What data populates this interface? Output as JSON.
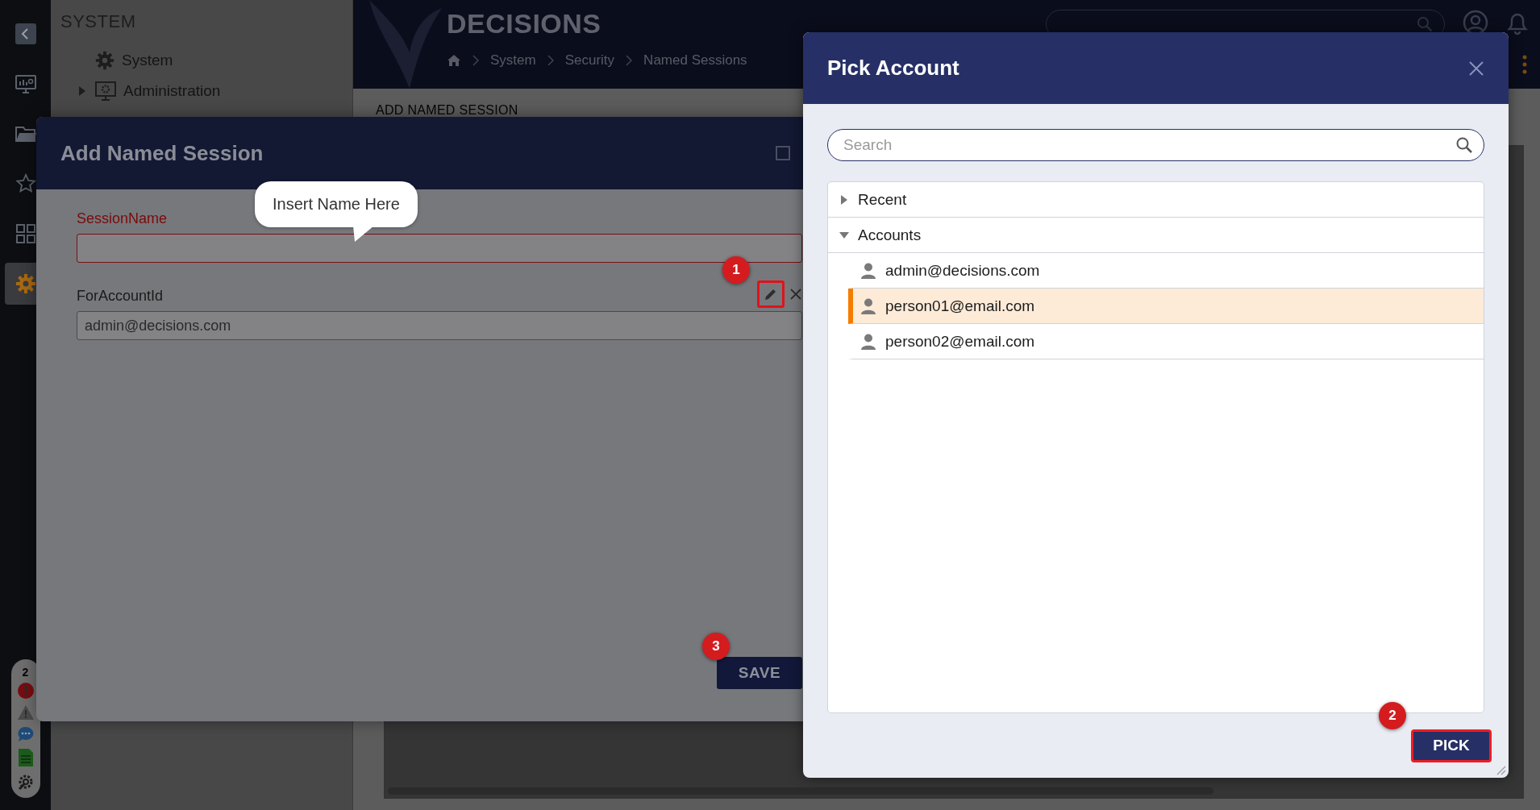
{
  "nav_rail": {
    "items": [
      {
        "selected": false
      },
      {
        "selected": false
      },
      {
        "selected": false
      },
      {
        "selected": false
      },
      {
        "selected": false
      },
      {
        "selected": true
      }
    ],
    "notifications": {
      "count": "2"
    }
  },
  "sidebar": {
    "title": "SYSTEM",
    "items": [
      {
        "label": "System"
      },
      {
        "label": "Administration",
        "expanded": false
      }
    ]
  },
  "header": {
    "brand": "DECISIONS",
    "breadcrumb": [
      "System",
      "Security",
      "Named Sessions"
    ]
  },
  "page": {
    "heading": "ADD NAMED SESSION"
  },
  "add_dialog": {
    "title": "Add Named Session",
    "tooltip": "Insert Name Here",
    "fields": [
      {
        "label": "SessionName",
        "invalid": true
      },
      {
        "label": "ForAccountId",
        "value": "admin@decisions.com",
        "invalid": false,
        "edit_highlighted": true,
        "callout": "1"
      }
    ],
    "button": "SAVE",
    "button_callout": "3"
  },
  "pick_dialog": {
    "title": "Pick Account",
    "search": {
      "placeholder": "Search"
    },
    "tree": [
      {
        "label": "Recent",
        "expanded": false
      },
      {
        "label": "Accounts",
        "expanded": true,
        "children": [
          {
            "label": "admin@decisions.com",
            "selected": false
          },
          {
            "label": "person01@email.com",
            "selected": true
          },
          {
            "label": "person02@email.com",
            "selected": false
          }
        ]
      }
    ],
    "button": "PICK",
    "button_highlighted": true,
    "button_callout": "2"
  }
}
